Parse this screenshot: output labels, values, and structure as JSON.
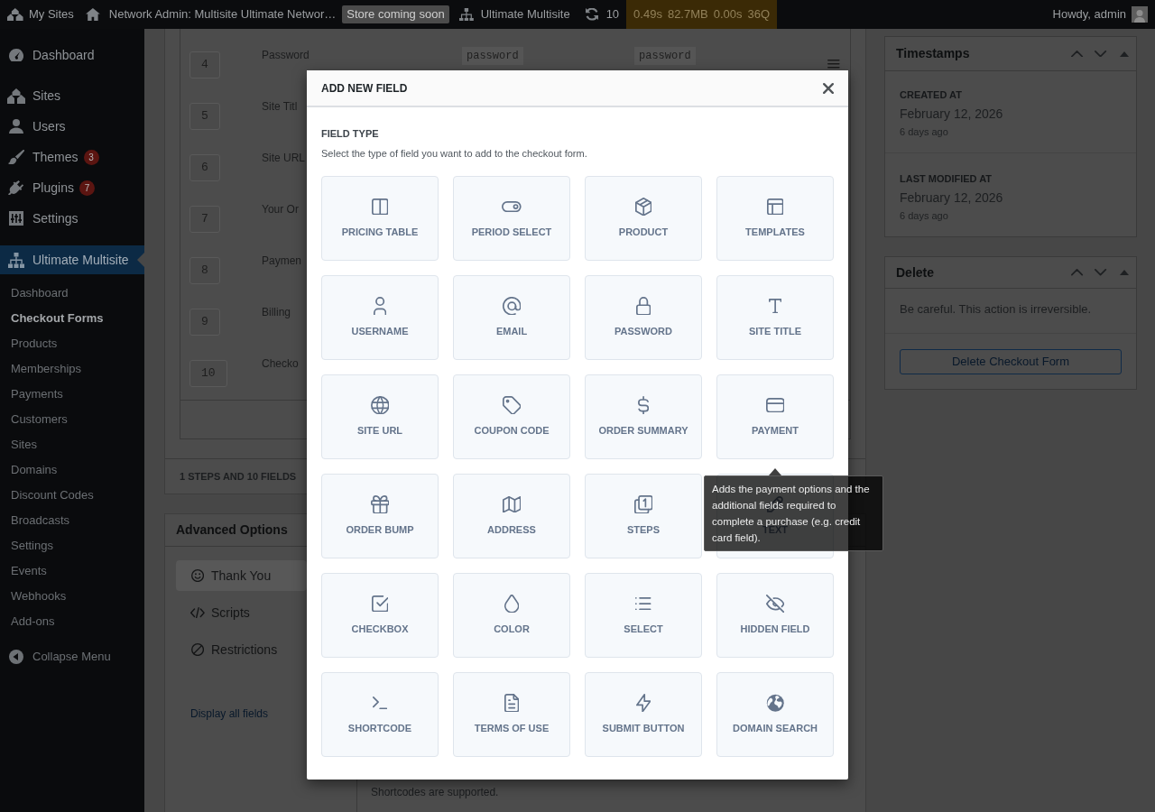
{
  "admin_bar": {
    "items": [
      {
        "kind": "sites",
        "label": "My Sites"
      },
      {
        "kind": "home",
        "label": "Network Admin: Multisite Ultimate Networ…"
      },
      {
        "kind": "status",
        "label": "Store coming soon"
      },
      {
        "kind": "network",
        "label": "Ultimate Multisite"
      },
      {
        "kind": "updates",
        "label": "10"
      }
    ],
    "query_monitor": [
      "0.49s",
      "82.7MB",
      "0.00s",
      "36Q"
    ],
    "greeting": "Howdy, admin"
  },
  "sidebar": {
    "sections": [
      {
        "items": [
          {
            "kind": "dashboard",
            "label": "Dashboard",
            "selected": false
          }
        ]
      },
      {
        "items": [
          {
            "kind": "sites",
            "label": "Sites",
            "selected": false
          },
          {
            "kind": "users",
            "label": "Users",
            "selected": false
          },
          {
            "kind": "themes",
            "label": "Themes",
            "badge": "3",
            "selected": false
          },
          {
            "kind": "plugins",
            "label": "Plugins",
            "badge": "7",
            "selected": false
          },
          {
            "kind": "settings",
            "label": "Settings",
            "selected": false
          }
        ]
      },
      {
        "items": [
          {
            "kind": "network",
            "label": "Ultimate Multisite",
            "selected": true,
            "submenu": [
              {
                "label": "Dashboard",
                "selected": false
              },
              {
                "label": "Checkout Forms",
                "selected": true
              },
              {
                "label": "Products",
                "selected": false
              },
              {
                "label": "Memberships",
                "selected": false
              },
              {
                "label": "Payments",
                "selected": false
              },
              {
                "label": "Customers",
                "selected": false
              },
              {
                "label": "Sites",
                "selected": false
              },
              {
                "label": "Domains",
                "selected": false
              },
              {
                "label": "Discount Codes",
                "selected": false
              },
              {
                "label": "Broadcasts",
                "selected": false
              },
              {
                "label": "Settings",
                "selected": false
              },
              {
                "label": "Events",
                "selected": false
              },
              {
                "label": "Webhooks",
                "selected": false
              },
              {
                "label": "Add-ons",
                "selected": false
              }
            ]
          }
        ]
      }
    ],
    "collapse": "Collapse Menu"
  },
  "form_fields": {
    "rows": [
      {
        "order": "4",
        "label": "Password",
        "cells": [
          "password",
          "password"
        ]
      },
      {
        "order": "5",
        "label": "Site Titl"
      },
      {
        "order": "6",
        "label": "Site URL"
      },
      {
        "order": "7",
        "label": "Your Or"
      },
      {
        "order": "8",
        "label": "Paymen"
      },
      {
        "order": "9",
        "label": "Billing"
      },
      {
        "order": "10",
        "label": "Checko"
      }
    ],
    "summary": "1 STEPS AND 10 FIELDS"
  },
  "advanced_options": {
    "title": "Advanced Options",
    "tabs": [
      {
        "kind": "smile",
        "label": "Thank You",
        "selected": true
      },
      {
        "kind": "code",
        "label": "Scripts",
        "selected": false
      },
      {
        "kind": "blocked",
        "label": "Restrictions",
        "selected": false
      }
    ],
    "link": "Display all fields",
    "note": "Shortcodes are supported."
  },
  "timestamps": {
    "title": "Timestamps",
    "entries": [
      {
        "label": "CREATED AT",
        "date": "February 12, 2026",
        "relative": "6 days ago"
      },
      {
        "label": "LAST MODIFIED AT",
        "date": "February 12, 2026",
        "relative": "6 days ago"
      }
    ]
  },
  "delete": {
    "title": "Delete",
    "warning": "Be careful. This action is irreversible.",
    "button": "Delete Checkout Form"
  },
  "modal": {
    "title": "ADD NEW FIELD",
    "section": "FIELD TYPE",
    "description": "Select the type of field you want to add to the checkout form.",
    "field_types": [
      {
        "kind": "pricing_table",
        "label": "PRICING TABLE"
      },
      {
        "kind": "period_select",
        "label": "PERIOD SELECT"
      },
      {
        "kind": "product",
        "label": "PRODUCT"
      },
      {
        "kind": "templates",
        "label": "TEMPLATES"
      },
      {
        "kind": "username",
        "label": "USERNAME"
      },
      {
        "kind": "email",
        "label": "EMAIL"
      },
      {
        "kind": "password",
        "label": "PASSWORD"
      },
      {
        "kind": "site_title",
        "label": "SITE TITLE"
      },
      {
        "kind": "site_url",
        "label": "SITE URL"
      },
      {
        "kind": "coupon_code",
        "label": "COUPON CODE"
      },
      {
        "kind": "order_summary",
        "label": "ORDER SUMMARY"
      },
      {
        "kind": "payment",
        "label": "PAYMENT"
      },
      {
        "kind": "order_bump",
        "label": "ORDER BUMP"
      },
      {
        "kind": "address",
        "label": "ADDRESS"
      },
      {
        "kind": "steps",
        "label": "STEPS"
      },
      {
        "kind": "text",
        "label": "TEXT"
      },
      {
        "kind": "checkbox",
        "label": "CHECKBOX"
      },
      {
        "kind": "color",
        "label": "COLOR"
      },
      {
        "kind": "select",
        "label": "SELECT"
      },
      {
        "kind": "hidden_field",
        "label": "HIDDEN FIELD"
      },
      {
        "kind": "shortcode",
        "label": "SHORTCODE"
      },
      {
        "kind": "terms_of_use",
        "label": "TERMS OF USE"
      },
      {
        "kind": "submit_button",
        "label": "SUBMIT BUTTON"
      },
      {
        "kind": "domain_search",
        "label": "DOMAIN SEARCH"
      }
    ],
    "tooltip": "Adds the payment options and the additional fields required to complete a purchase (e.g. credit card field)."
  }
}
